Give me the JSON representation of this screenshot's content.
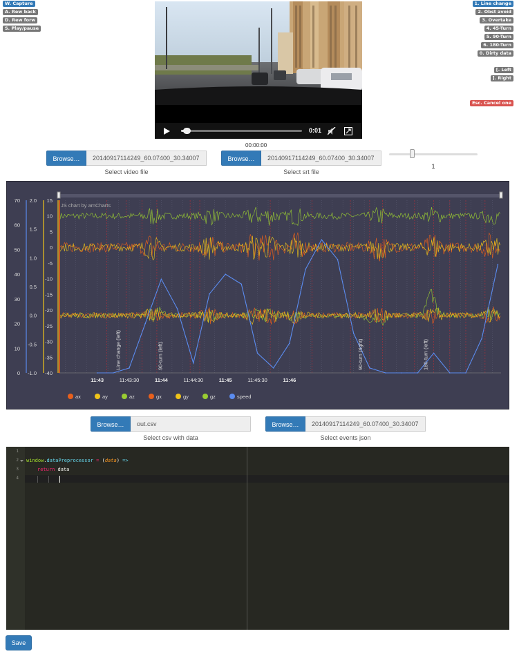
{
  "left_shortcuts": [
    "W. Capture",
    "A. Rew back",
    "D. Rew forw",
    "S. Play/pause"
  ],
  "right_shortcuts": [
    "1. Line change",
    "2. Obst avoid",
    "3. Overtake",
    "4. 45-Turn",
    "5. 90-Turn",
    "6. 180-Turn",
    "0. Dirty data"
  ],
  "dir_shortcuts": [
    "[. Left",
    "]. Right"
  ],
  "cancel_shortcut": "Esc. Cancel one",
  "video": {
    "current_time": "0:01",
    "progress": 0.03,
    "timestamp": "00:00:00"
  },
  "video_input": {
    "button": "Browse…",
    "filename": "20140917114249_60.07400_30.34007",
    "caption": "Select video file"
  },
  "srt_input": {
    "button": "Browse…",
    "filename": "20140917114249_60.07400_30.34007",
    "caption": "Select srt file"
  },
  "speed_slider": {
    "value_text": "1",
    "position": 0.26
  },
  "csv_input": {
    "button": "Browse…",
    "filename": "out.csv",
    "caption": "Select csv with data"
  },
  "events_input": {
    "button": "Browse…",
    "filename": "20140917114249_60.07400_30.34007",
    "caption": "Select events json"
  },
  "chart_data": {
    "type": "line",
    "credit": "JS chart by amCharts",
    "background": "#3e3e52",
    "axes": {
      "speed": {
        "ticks": [
          "70",
          "60",
          "50",
          "40",
          "30",
          "20",
          "10",
          "0"
        ],
        "range": [
          0,
          70
        ],
        "color": "#5b8cf0"
      },
      "gyro": {
        "ticks": [
          "2.0",
          "1.5",
          "1.0",
          "0.5",
          "0.0",
          "-0.5",
          "-1.0"
        ],
        "range": [
          -1.0,
          2.0
        ],
        "color": "#f0c419"
      },
      "accel": {
        "ticks": [
          "15",
          "10",
          "5",
          "0",
          "-5",
          "-10",
          "-15",
          "-20",
          "-25",
          "-30",
          "-35",
          "-40"
        ],
        "range": [
          -40,
          15
        ],
        "color": "#f0c419"
      }
    },
    "x_ticks": [
      "11:43",
      "11:43:30",
      "11:44",
      "11:44:30",
      "11:45",
      "11:45:30",
      "11:46"
    ],
    "x_ticks_bold": [
      true,
      false,
      true,
      false,
      true,
      false,
      true
    ],
    "series": [
      {
        "name": "ax",
        "color": "#e8601c",
        "baseline": 0,
        "amp": 1.6
      },
      {
        "name": "ay",
        "color": "#f0c419",
        "baseline": 0,
        "amp": 1.3
      },
      {
        "name": "az",
        "color": "#9acd32",
        "baseline": 10,
        "amp": 1.0
      },
      {
        "name": "gx",
        "color": "#e8601c",
        "baseline": 0.0,
        "amp": 0.05
      },
      {
        "name": "gy",
        "color": "#f0c419",
        "baseline": 0.0,
        "amp": 0.05
      },
      {
        "name": "gz",
        "color": "#9acd32",
        "baseline": 0.0,
        "amp": 0.04
      },
      {
        "name": "speed",
        "color": "#5b8cf0",
        "x_min": [
          0,
          0.25,
          0.5,
          0.75,
          1.0,
          1.25,
          1.5,
          1.75,
          2.0,
          2.25,
          2.5,
          2.75,
          3.0,
          3.25,
          3.5,
          3.75,
          4.0,
          4.25,
          4.5,
          4.75,
          5.0,
          5.25,
          5.5,
          5.75,
          6.0,
          6.25
        ],
        "values": [
          0,
          0,
          2,
          20,
          38,
          26,
          4,
          32,
          40,
          36,
          8,
          2,
          12,
          42,
          54,
          46,
          16,
          2,
          0,
          0,
          0,
          8,
          0,
          0,
          14,
          44
        ]
      }
    ],
    "events": [
      {
        "label": "Line change (left)",
        "x_min": 0.32
      },
      {
        "label": "90-turn (left)",
        "x_min": 0.98
      },
      {
        "label": "90-turn (right)",
        "x_min": 4.1
      },
      {
        "label": "180-turn (left)",
        "x_min": 5.12
      }
    ]
  },
  "editor": {
    "line_numbers": [
      "1",
      "2",
      "3",
      "4"
    ],
    "code": {
      "obj": "window",
      "dot": ".",
      "prop": "dataPreprocessor",
      "eq": " = ",
      "lp": "(",
      "arg": "data",
      "rp": ")",
      "arrow": " =>",
      "ret": "return",
      "retval": " data"
    }
  },
  "save_button": "Save"
}
